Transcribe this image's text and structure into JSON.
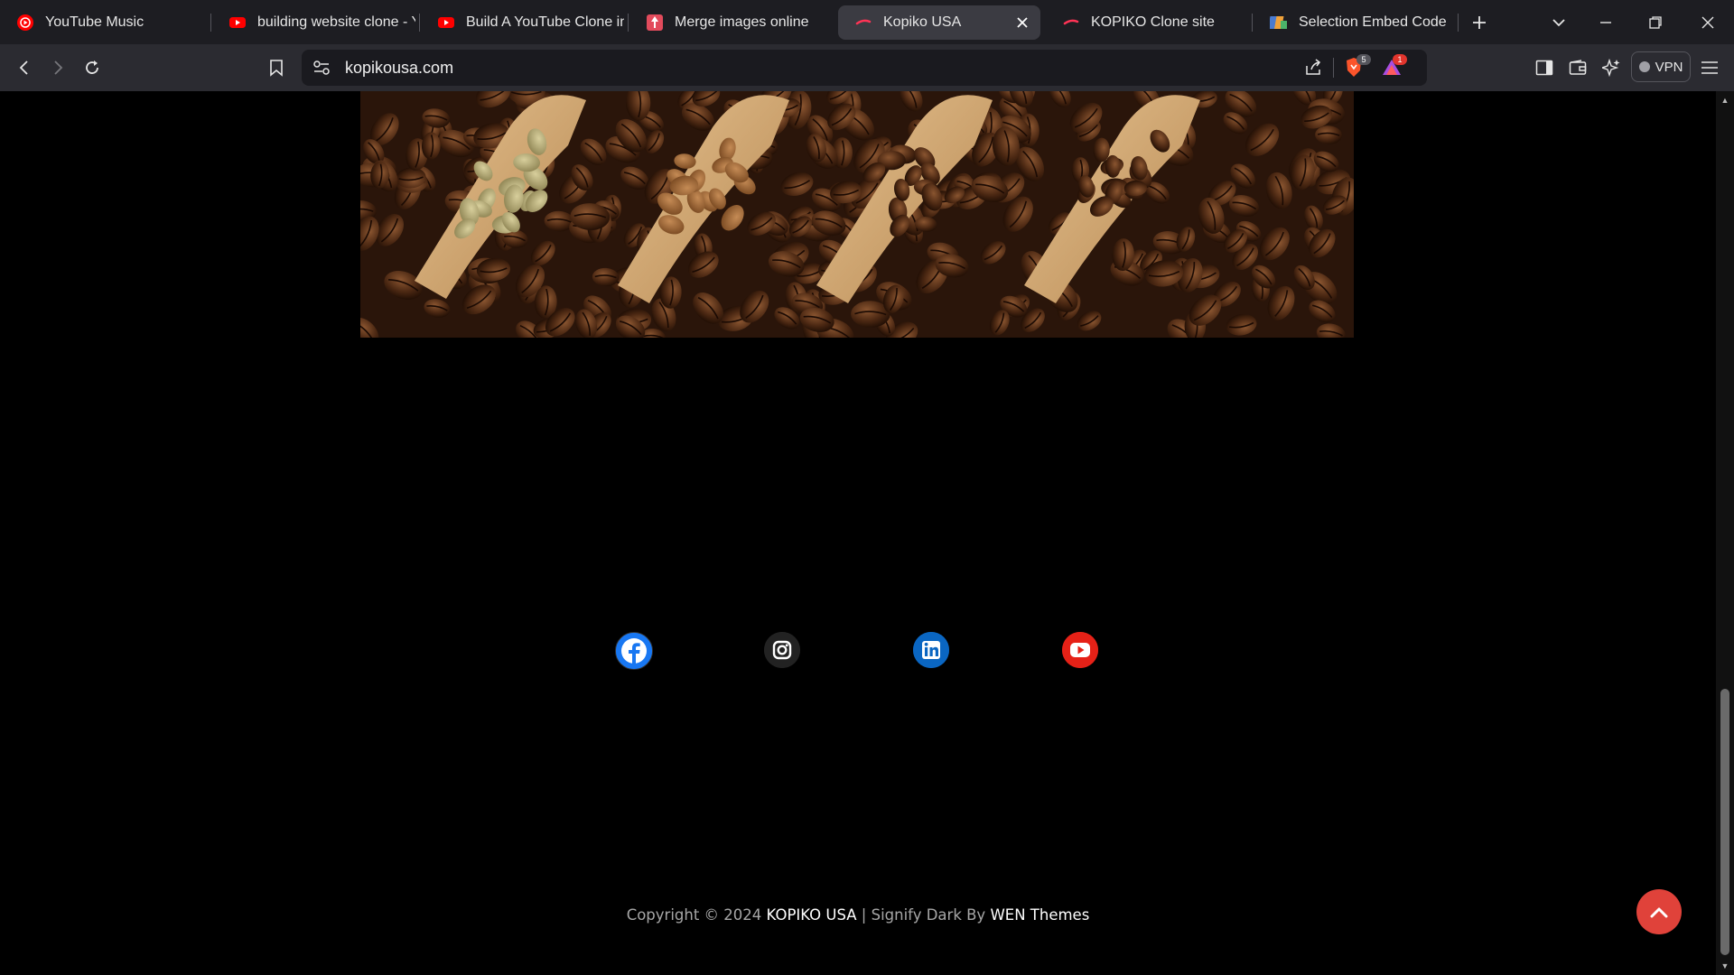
{
  "tabs": [
    {
      "title": "YouTube Music",
      "favicon": "youtube-music-icon"
    },
    {
      "title": "building website clone - Y",
      "favicon": "youtube-icon"
    },
    {
      "title": "Build A YouTube Clone in",
      "favicon": "youtube-icon"
    },
    {
      "title": "Merge images online",
      "favicon": "merge-images-icon"
    },
    {
      "title": "Kopiko USA",
      "favicon": "kopiko-icon",
      "active": true
    },
    {
      "title": "KOPIKO Clone site",
      "favicon": "kopiko-icon"
    },
    {
      "title": "Selection Embed Code - C",
      "favicon": "embed-code-icon"
    }
  ],
  "address_bar": {
    "url": "kopikousa.com"
  },
  "toolbar": {
    "vpn_label": "VPN",
    "brave_shield_count": "5",
    "rewards_count": "1"
  },
  "page": {
    "banner_image": "coffee-beans-scoops-banner",
    "social_links": [
      {
        "name": "facebook",
        "color": "#1877f2"
      },
      {
        "name": "instagram",
        "color": "#222222"
      },
      {
        "name": "linkedin",
        "color": "#0a66c2"
      },
      {
        "name": "youtube",
        "color": "#e62117"
      }
    ],
    "footer": {
      "prefix": "Copyright © 2024 ",
      "site_name": "KOPIKO USA",
      "middle": " | Signify Dark By ",
      "theme_author": "WEN Themes"
    }
  },
  "colors": {
    "page_background": "#000000",
    "scroll_top_button": "#e0423a",
    "tab_strip": "#1d1d22",
    "toolbar": "#2b2b31"
  }
}
